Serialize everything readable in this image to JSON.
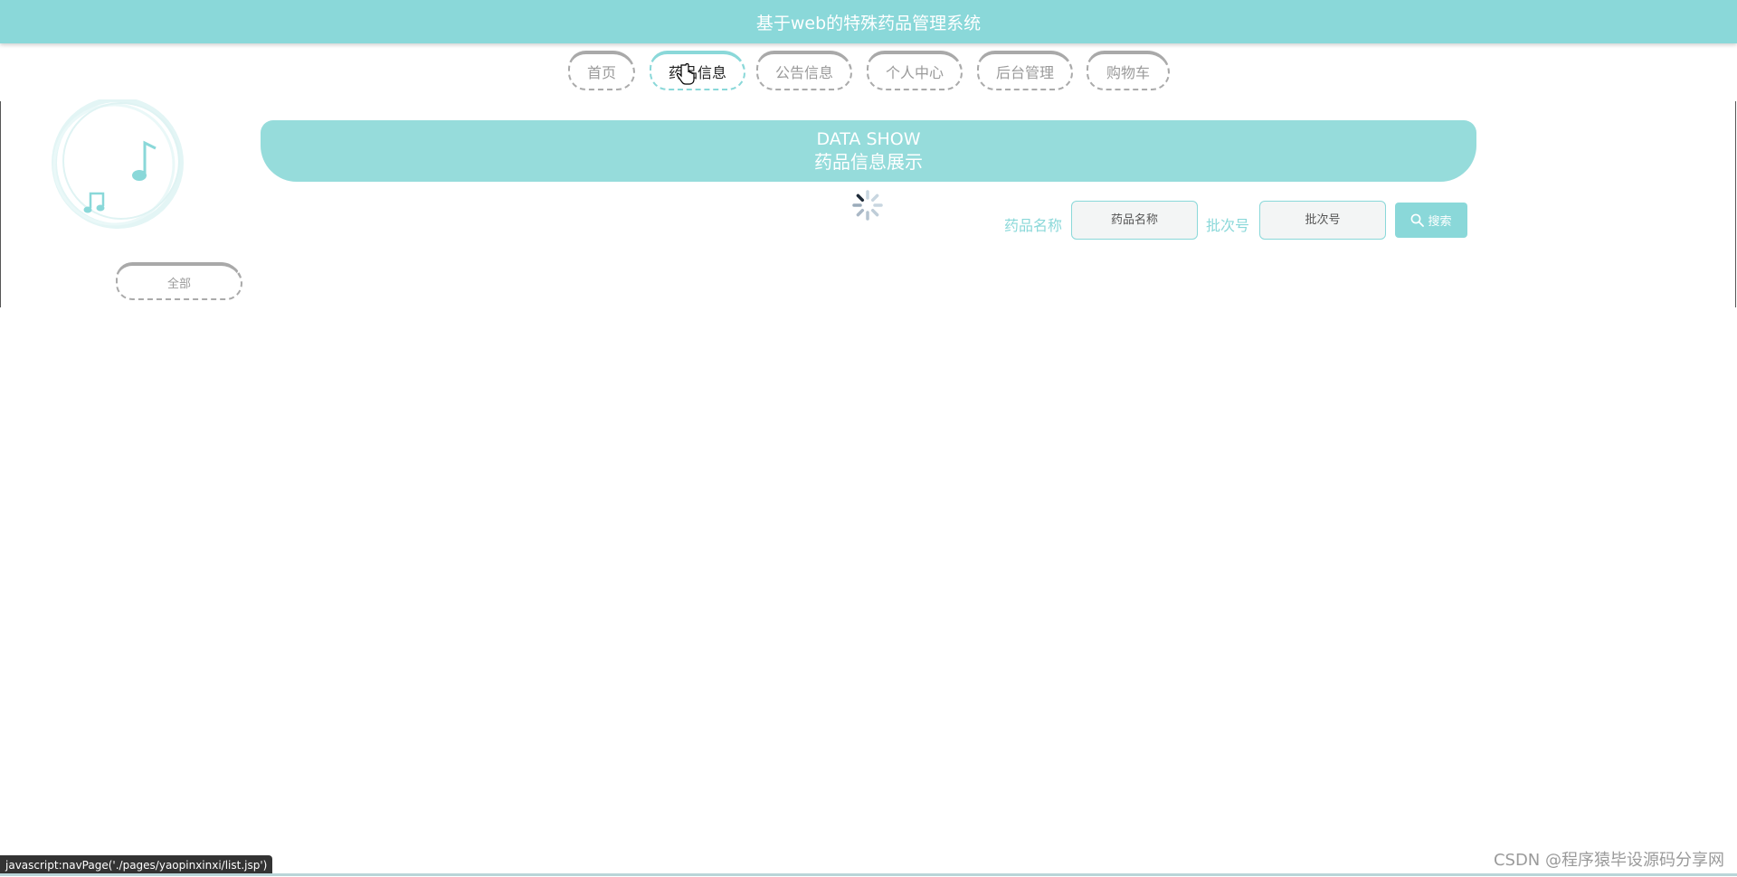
{
  "header": {
    "title": "基于web的特殊药品管理系统"
  },
  "nav": {
    "items": [
      {
        "label": "首页"
      },
      {
        "label": "药品信息",
        "active": true
      },
      {
        "label": "公告信息"
      },
      {
        "label": "个人中心"
      },
      {
        "label": "后台管理"
      },
      {
        "label": "购物车"
      }
    ]
  },
  "hero": {
    "en_title": "DATA SHOW",
    "cn_title": "药品信息展示"
  },
  "search": {
    "name_label": "药品名称",
    "name_placeholder": "药品名称",
    "batch_label": "批次号",
    "batch_placeholder": "批次号",
    "button_label": "搜索"
  },
  "filter": {
    "all_label": "全部"
  },
  "statusbar": {
    "text": "javascript:navPage('./pages/yaopinxinxi/list.jsp')"
  },
  "watermark": {
    "text": "CSDN @程序猿毕设源码分享网"
  },
  "colors": {
    "accent": "#8ad8d9",
    "hero": "#96dcdb"
  }
}
